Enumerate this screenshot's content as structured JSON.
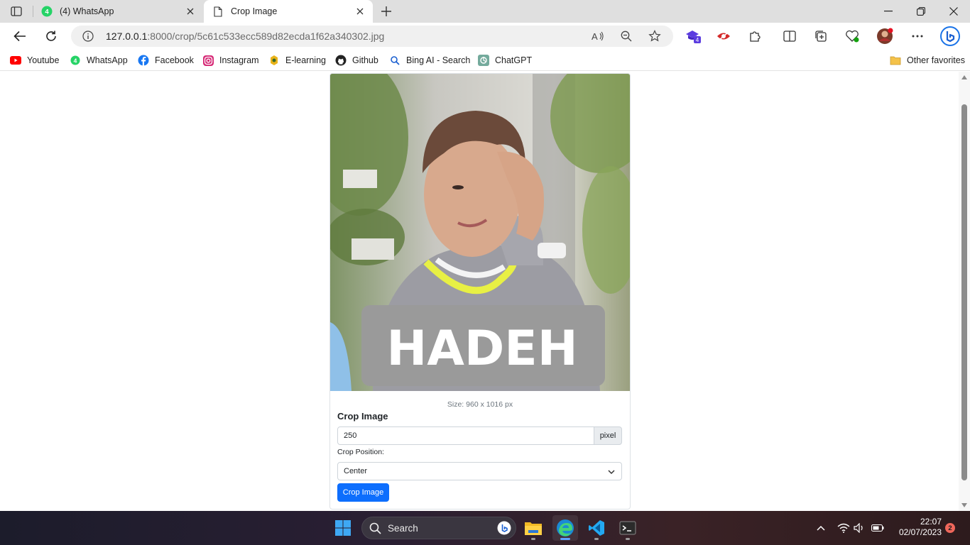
{
  "browser": {
    "tabs": [
      {
        "label": "(4) WhatsApp",
        "badge": "4",
        "active": false
      },
      {
        "label": "Crop Image",
        "active": true
      }
    ],
    "url_host": "127.0.0.1",
    "url_rest": ":8000/crop/5c61c533ecc589d82ecda1f62a340302.jpg",
    "extension_badge": "4",
    "bookmarks": [
      {
        "label": "Youtube",
        "icon": "youtube-icon"
      },
      {
        "label": "WhatsApp",
        "icon": "whatsapp-icon"
      },
      {
        "label": "Facebook",
        "icon": "facebook-icon"
      },
      {
        "label": "Instagram",
        "icon": "instagram-icon"
      },
      {
        "label": "E-learning",
        "icon": "elearning-icon"
      },
      {
        "label": "Github",
        "icon": "github-icon"
      },
      {
        "label": "Bing AI - Search",
        "icon": "bing-search-icon"
      },
      {
        "label": "ChatGPT",
        "icon": "chatgpt-icon"
      }
    ],
    "other_favorites": "Other favorites"
  },
  "page": {
    "image_caption": "HADEH",
    "size_text": "Size: 960 x 1016 px",
    "form_title": "Crop Image",
    "crop_value": "250",
    "crop_unit": "pixel",
    "position_label": "Crop Position:",
    "position_selected": "Center",
    "submit_label": "Crop Image"
  },
  "taskbar": {
    "search_label": "Search",
    "time": "22:07",
    "date": "02/07/2023",
    "notifications": "2"
  },
  "colors": {
    "primary_button": "#0d6efd",
    "whatsapp_green": "#25d366",
    "youtube_red": "#ff0000"
  }
}
